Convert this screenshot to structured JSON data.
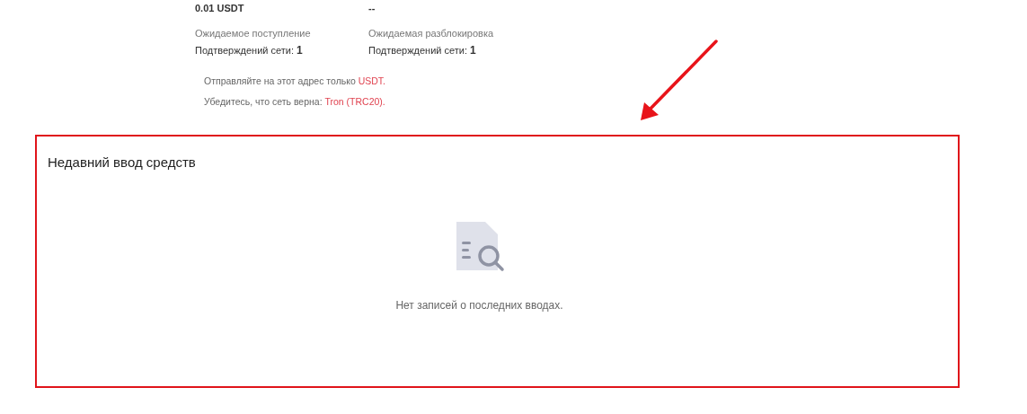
{
  "summary": [
    {
      "value": "0.01 USDT",
      "label": "Ожидаемое поступление",
      "confirmations": "Подтверждений сети: **1**"
    },
    {
      "value": "--",
      "label": "Ожидаемая разблокировка",
      "confirmations": "Подтверждений сети: **1**"
    }
  ],
  "notes": [
    {
      "segments": [
        {
          "text": "Отправляйте на этот адрес только ",
          "highlight": false
        },
        {
          "text": "USDT.",
          "highlight": true
        }
      ]
    },
    {
      "segments": [
        {
          "text": "Убедитесь, что сеть верна: ",
          "highlight": false
        },
        {
          "text": "Tron (TRC20).",
          "highlight": true
        }
      ]
    }
  ],
  "recent_deposits": {
    "title": "Недавний ввод средств",
    "empty_message": "Нет записей о последних вводах."
  }
}
